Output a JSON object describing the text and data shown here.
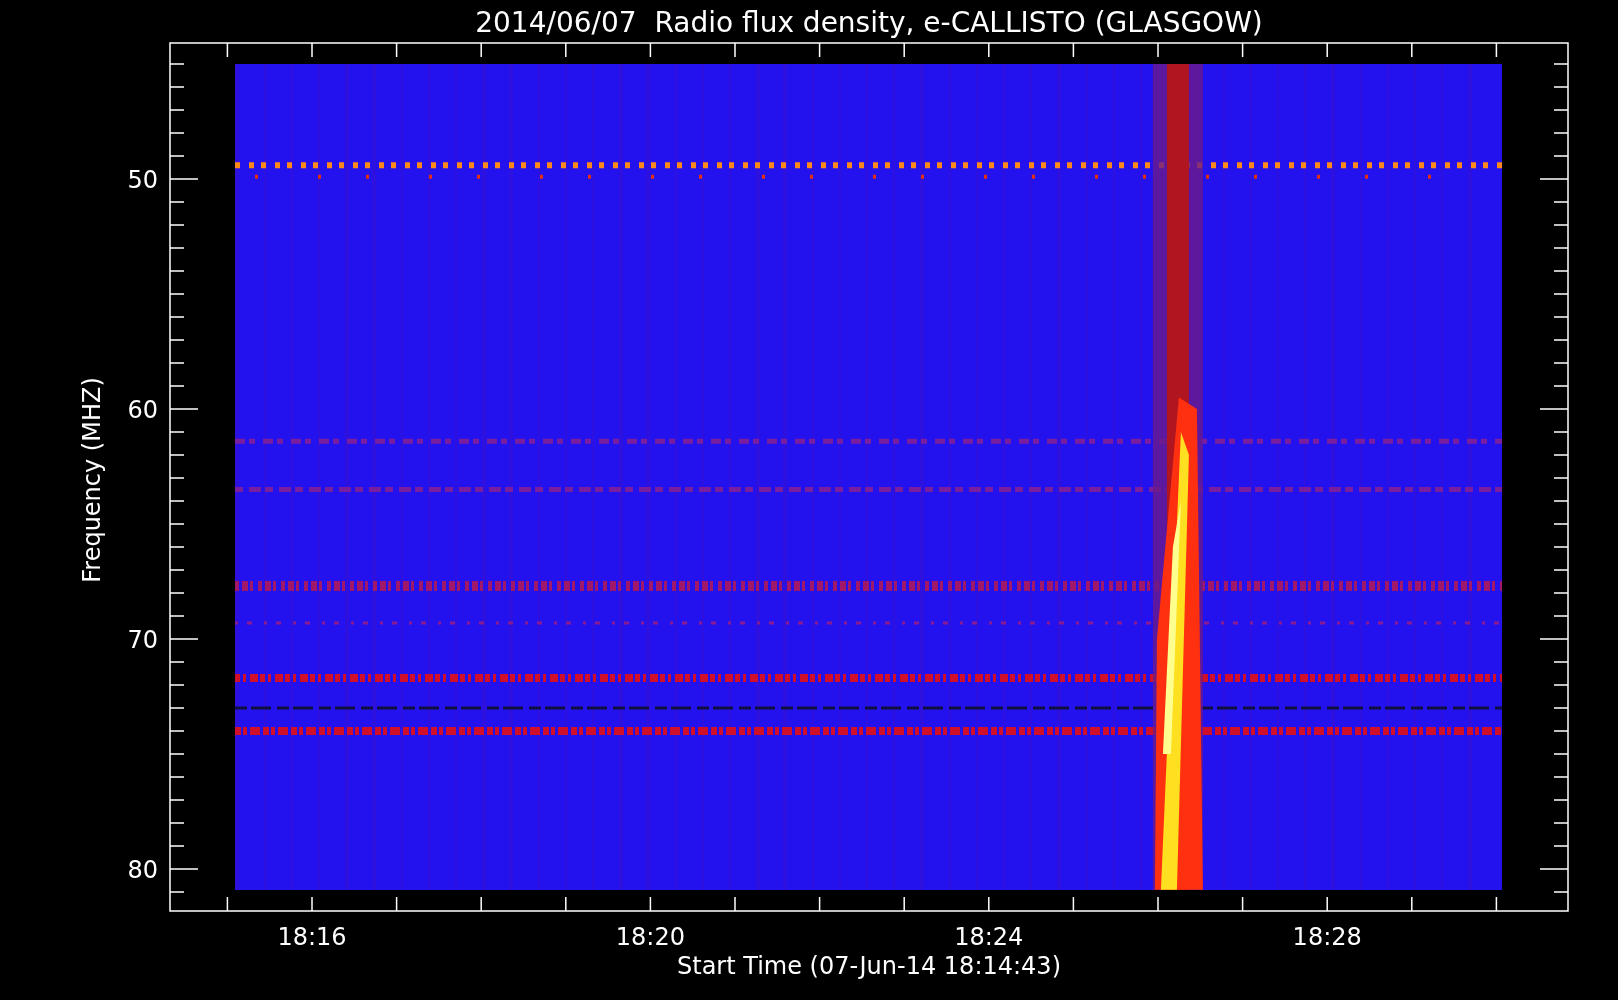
{
  "title": "2014/06/07  Radio flux density, e-CALLISTO (GLASGOW)",
  "plot": {
    "ylabel": "Frequency (MHZ)",
    "xlabel": "Start Time (07-Jun-14 18:14:43)",
    "xtick_labels": [
      "18:16",
      "18:20",
      "18:24",
      "18:28"
    ],
    "ytick_labels": [
      "50",
      "60",
      "70",
      "80"
    ]
  }
}
